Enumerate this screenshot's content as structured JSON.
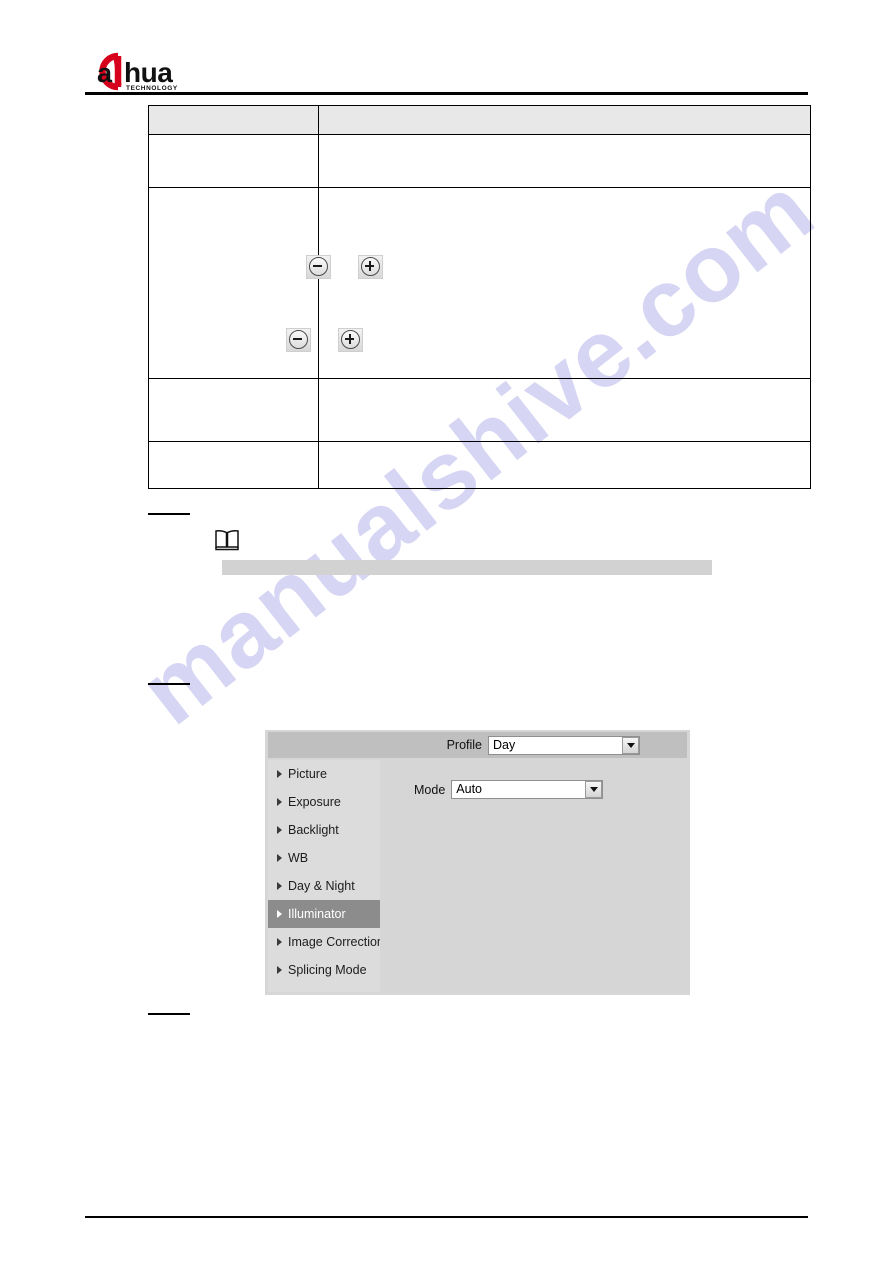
{
  "document": {
    "brand": "dahua",
    "brand_tagline": "TECHNOLOGY",
    "watermark": "manualshive.com"
  },
  "parameter_table": {
    "headers": [
      "",
      ""
    ],
    "rows": [
      {
        "name": "",
        "description": ""
      },
      {
        "name": "",
        "description": ""
      },
      {
        "name": "",
        "description": ""
      },
      {
        "name": "",
        "description": ""
      }
    ],
    "steppers": [
      {
        "minus_label": "−",
        "plus_label": "+"
      },
      {
        "minus_label": "−",
        "plus_label": "+"
      }
    ]
  },
  "note": {
    "icon": "book-note-icon",
    "body": ""
  },
  "config_panel": {
    "header": {
      "profile_label": "Profile",
      "profile_value": "Day",
      "profile_options": [
        "Day"
      ]
    },
    "sidebar": {
      "items": [
        {
          "label": "Picture",
          "selected": false
        },
        {
          "label": "Exposure",
          "selected": false
        },
        {
          "label": "Backlight",
          "selected": false
        },
        {
          "label": "WB",
          "selected": false
        },
        {
          "label": "Day & Night",
          "selected": false
        },
        {
          "label": "Illuminator",
          "selected": true
        },
        {
          "label": "Image Correction",
          "selected": false
        },
        {
          "label": "Splicing Mode",
          "selected": false
        }
      ]
    },
    "content": {
      "mode_label": "Mode",
      "mode_value": "Auto",
      "mode_options": [
        "Auto"
      ]
    }
  },
  "colors": {
    "brand_red": "#d6001c",
    "table_header_bg": "#e8e8e8",
    "panel_bg": "#d6d6d6",
    "panel_header_bg": "#bfbfbf",
    "sidebar_bg": "#dcdcdc",
    "selected_bg": "#8c8c8c",
    "note_bar": "#d2d2d2",
    "watermark": "#c9c8ef"
  }
}
